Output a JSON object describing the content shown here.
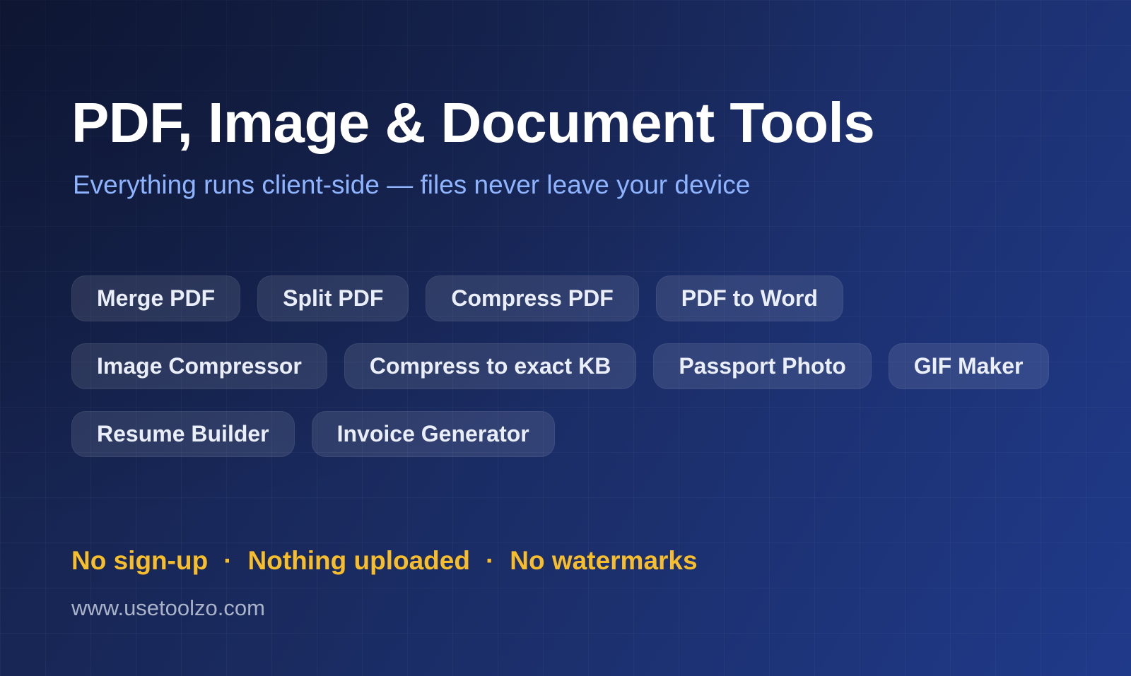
{
  "header": {
    "title": "PDF, Image & Document Tools",
    "subtitle": "Everything runs client-side — files never leave your device"
  },
  "tools": {
    "row1": [
      "Merge PDF",
      "Split PDF",
      "Compress PDF",
      "PDF to Word"
    ],
    "row2": [
      "Image Compressor",
      "Compress to exact KB",
      "Passport Photo",
      "GIF Maker"
    ],
    "row3": [
      "Resume Builder",
      "Invoice Generator"
    ]
  },
  "features": {
    "items": [
      "No sign-up",
      "Nothing uploaded",
      "No watermarks"
    ],
    "separator": "·"
  },
  "footer": {
    "url": "www.usetoolzo.com"
  },
  "colors": {
    "background_start": "#141f45",
    "background_end": "#203a8a",
    "subtitle": "#8fb4ff",
    "accent": "#f8bd2a",
    "chip_text": "#e9eef8",
    "url_text": "#aab3c7"
  }
}
